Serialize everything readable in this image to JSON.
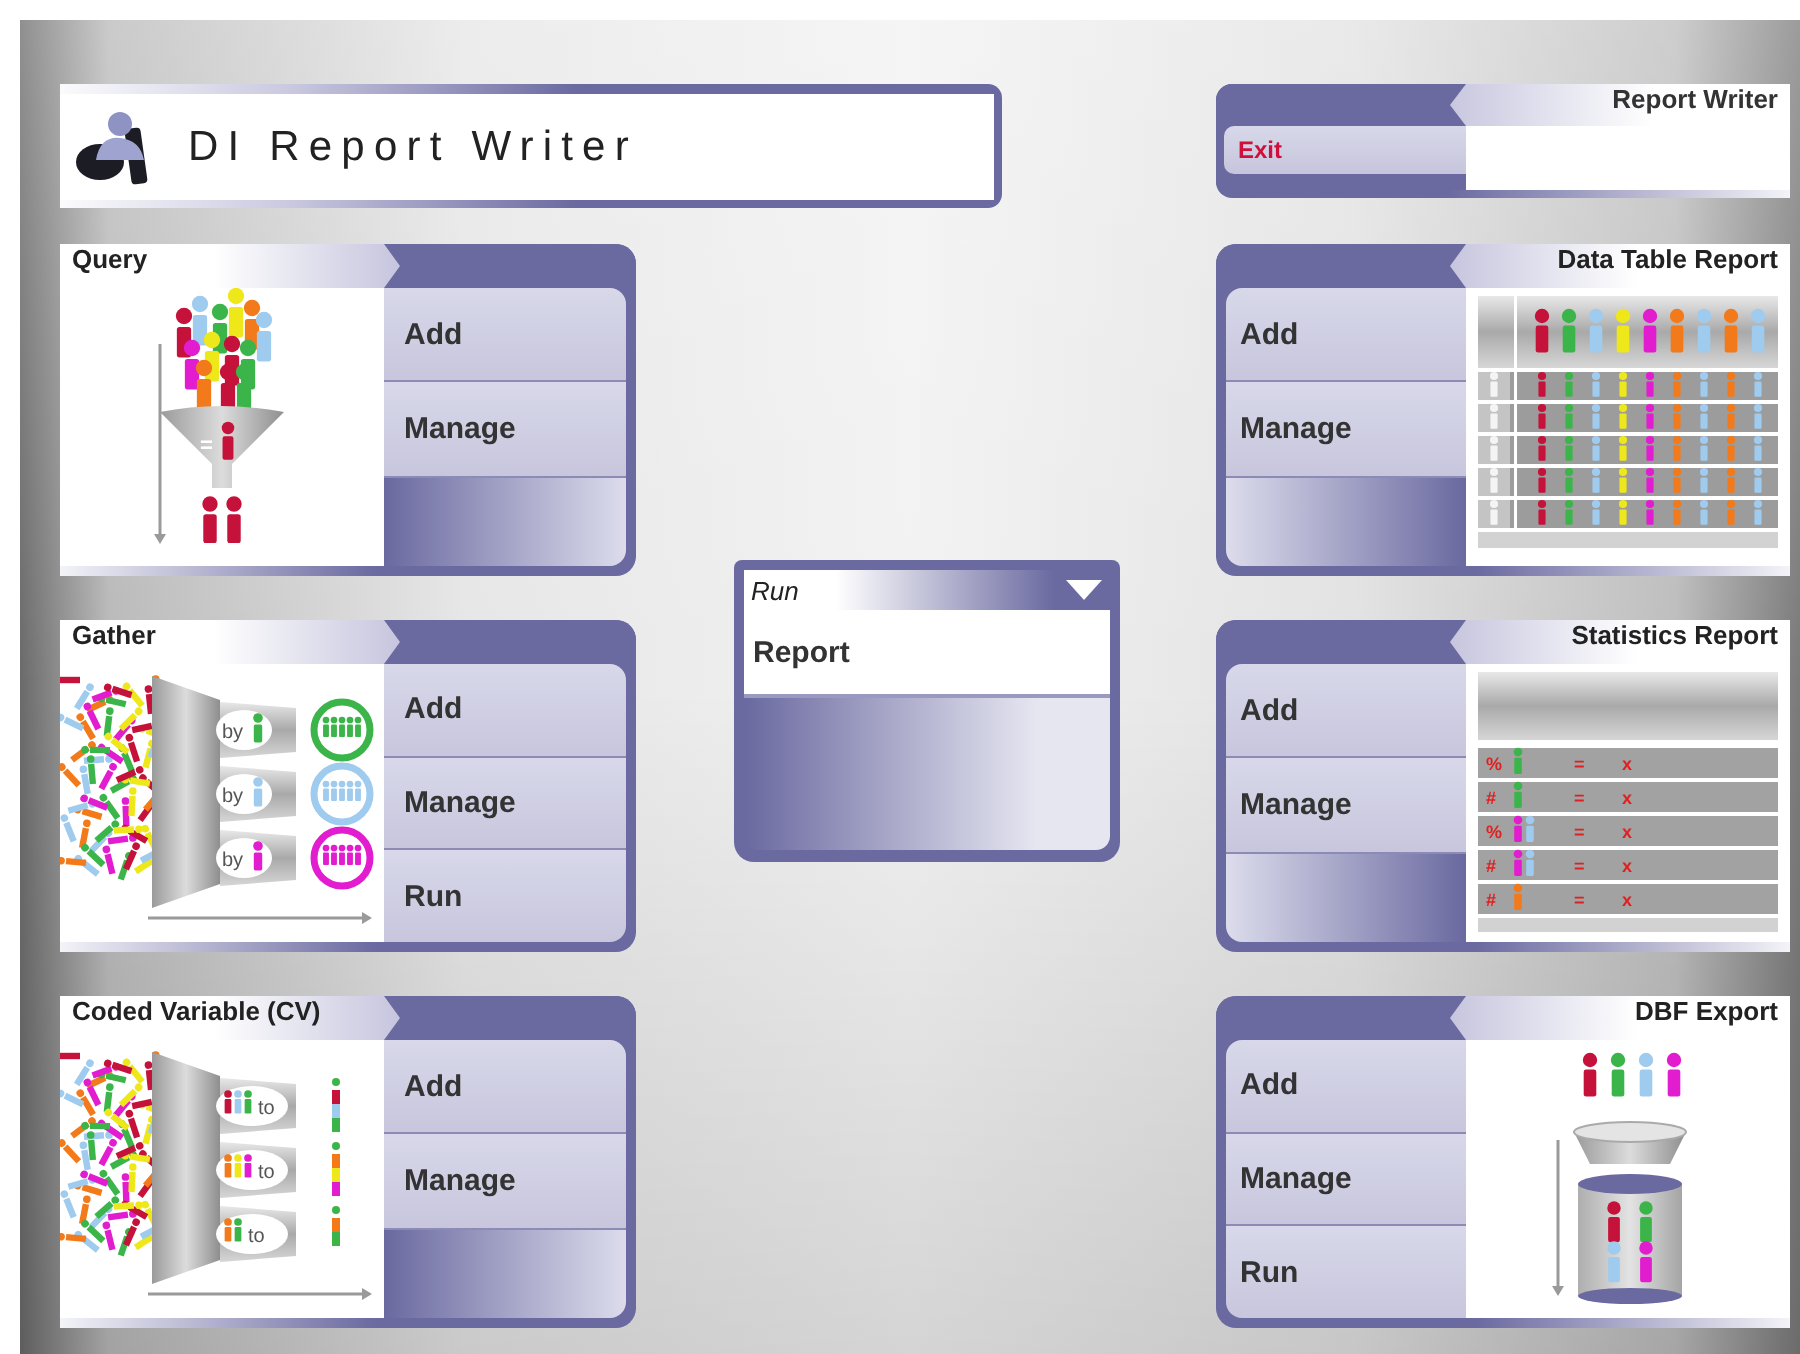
{
  "app_title": "DI Report Writer",
  "exit_panel": {
    "title": "Report Writer",
    "exit_button": "Exit"
  },
  "left_column": [
    {
      "title": "Query",
      "actions": [
        "Add",
        "Manage"
      ],
      "drawing": {
        "kind": "query",
        "labels": [
          "="
        ]
      }
    },
    {
      "title": "Gather",
      "actions": [
        "Add",
        "Manage",
        "Run"
      ],
      "drawing": {
        "kind": "gather",
        "labels": [
          "by",
          "by",
          "by"
        ]
      }
    },
    {
      "title": "Coded Variable (CV)",
      "actions": [
        "Add",
        "Manage"
      ],
      "drawing": {
        "kind": "coded",
        "labels": [
          "to",
          "to",
          "to"
        ]
      }
    }
  ],
  "run_panel": {
    "title": "Run",
    "items": [
      "Report"
    ]
  },
  "right_column": [
    {
      "title": "Data Table Report",
      "actions": [
        "Add",
        "Manage"
      ],
      "drawing": {
        "kind": "table"
      }
    },
    {
      "title": "Statistics Report",
      "actions": [
        "Add",
        "Manage"
      ],
      "drawing": {
        "kind": "stats",
        "rows": [
          {
            "symbol": "%",
            "equals": "=",
            "result": "x"
          },
          {
            "symbol": "#",
            "equals": "=",
            "result": "x"
          },
          {
            "symbol": "%",
            "equals": "=",
            "result": "x"
          },
          {
            "symbol": "#",
            "equals": "=",
            "result": "x"
          },
          {
            "symbol": "#",
            "equals": "=",
            "result": "x"
          }
        ]
      }
    },
    {
      "title": "DBF Export",
      "actions": [
        "Add",
        "Manage",
        "Run"
      ],
      "drawing": {
        "kind": "dbf"
      }
    }
  ]
}
